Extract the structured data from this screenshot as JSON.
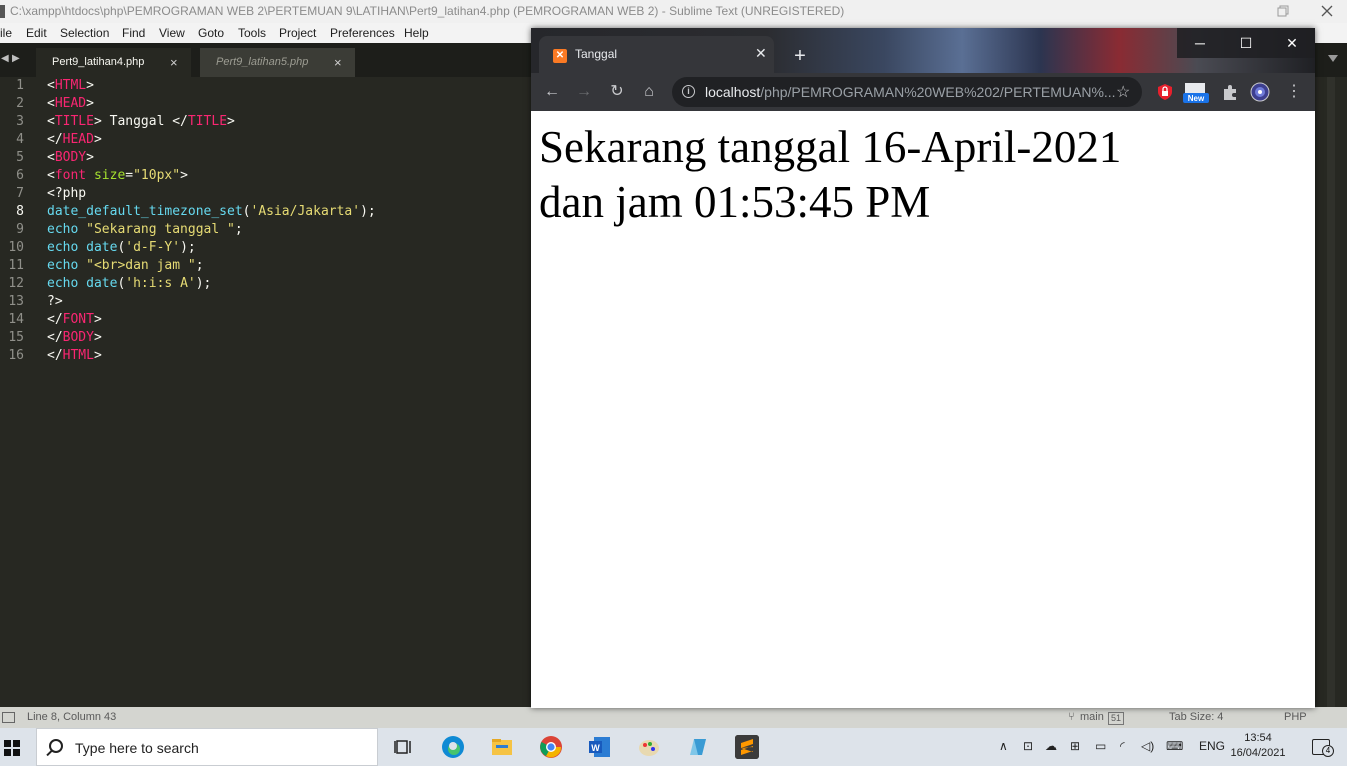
{
  "sublime": {
    "title": "C:\\xampp\\htdocs\\php\\PEMROGRAMAN WEB 2\\PERTEMUAN 9\\LATIHAN\\Pert9_latihan4.php (PEMROGRAMAN WEB 2) - Sublime Text (UNREGISTERED)",
    "menu": [
      "ile",
      "Edit",
      "Selection",
      "Find",
      "View",
      "Goto",
      "Tools",
      "Project",
      "Preferences",
      "Help"
    ],
    "tabs": [
      {
        "label": "Pert9_latihan4.php",
        "active": true
      },
      {
        "label": "Pert9_latihan5.php",
        "active": false
      }
    ],
    "tab_close": "×",
    "line_numbers": [
      "1",
      "2",
      "3",
      "4",
      "5",
      "6",
      "7",
      "8",
      "9",
      "10",
      "11",
      "12",
      "13",
      "14",
      "15",
      "16"
    ],
    "code": {
      "l1": [
        "<",
        "HTML",
        ">"
      ],
      "l2": [
        "<",
        "HEAD",
        ">"
      ],
      "l3": [
        "<",
        "TITLE",
        "> Tanggal </",
        "TITLE",
        ">"
      ],
      "l4": [
        "</",
        "HEAD",
        ">"
      ],
      "l5": [
        "<",
        "BODY",
        ">"
      ],
      "l6": [
        "<",
        "font",
        " ",
        "size",
        "=",
        "\"10px\"",
        ">"
      ],
      "l7": [
        "<?php"
      ],
      "l8": [
        "date_default_timezone_set",
        "(",
        "'Asia/Jakarta'",
        ");"
      ],
      "l9": [
        "echo",
        " ",
        "\"Sekarang tanggal \"",
        ";"
      ],
      "l10": [
        "echo",
        " ",
        "date",
        "(",
        "'d-F-Y'",
        ");"
      ],
      "l11": [
        "echo",
        " ",
        "\"<br>dan jam \"",
        ";"
      ],
      "l12": [
        "echo",
        " ",
        "date",
        "(",
        "'h:i:s A'",
        ");"
      ],
      "l13": [
        "?>"
      ],
      "l14": [
        "</",
        "FONT",
        ">"
      ],
      "l15": [
        "</",
        "BODY",
        ">"
      ],
      "l16": [
        "</",
        "HTML",
        ">"
      ]
    },
    "status": {
      "position": "Line 8, Column 43",
      "branch": "main",
      "branch_count": "51",
      "tab_size": "Tab Size: 4",
      "syntax": "PHP"
    }
  },
  "chrome": {
    "tab_title": "Tanggal",
    "new_tab": "+",
    "url_host": "localhost",
    "url_path": "/php/PEMROGRAMAN%20WEB%202/PERTEMUAN%...",
    "ext_badge": "New",
    "output_line1": "Sekarang tanggal 16-April-2021",
    "output_line2": "dan jam 01:53:45 PM"
  },
  "taskbar": {
    "search_placeholder": "Type here to search",
    "language": "ENG",
    "time": "13:54",
    "date": "16/04/2021",
    "notifications": "4"
  },
  "colors": {
    "editor_bg": "#272822",
    "tag": "#f92672",
    "attr": "#a6e22e",
    "string": "#e6db74",
    "function": "#66d9ef"
  }
}
